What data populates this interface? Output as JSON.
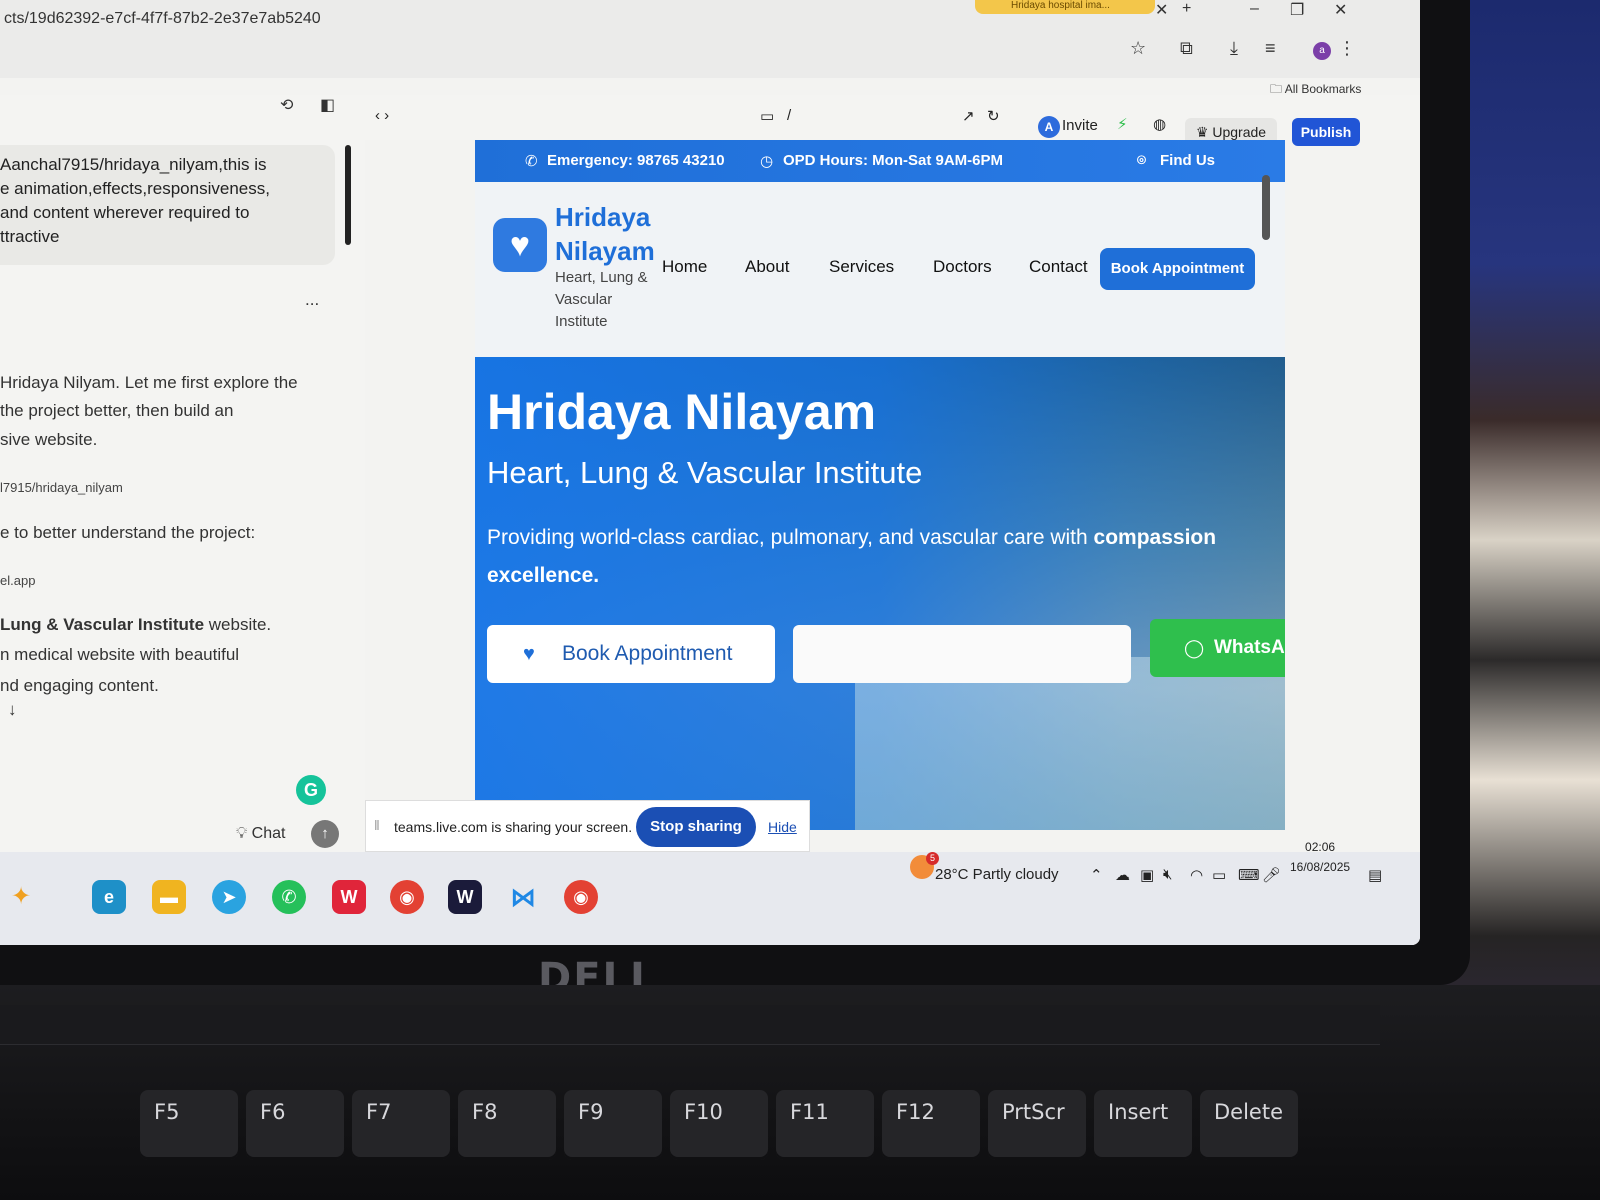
{
  "browser": {
    "url": "cts/19d62392-e7cf-4f7f-87b2-2e37e7ab5240",
    "tab_title": "Hridaya hospital ima...",
    "bookmarks_label": "All Bookmarks"
  },
  "editor": {
    "invite_label": "Invite",
    "invite_avatar": "A",
    "upgrade_label": "Upgrade",
    "publish_label": "Publish",
    "path_label": "/"
  },
  "chat": {
    "user_message": "Aanchal7915/hridaya_nilyam,this is\ne animation,effects,responsiveness,\n and content wherever required to\nttractive",
    "lines": [
      "Hridaya Nilyam. Let me first explore the",
      "the project better, then build an",
      "sive website."
    ],
    "repo_ref": "l7915/hridaya_nilyam",
    "understand_line": "e to better understand the project:",
    "app_ref": "el.app",
    "institute_bold": "Lung & Vascular Institute",
    "institute_rest": " website.",
    "medical_line": "n medical website with beautiful",
    "engaging_line": "nd engaging content.",
    "more_label": "...",
    "chat_label": "Chat"
  },
  "site": {
    "emergency": "Emergency: 98765 43210",
    "opd": "OPD Hours: Mon-Sat 9AM-6PM",
    "find_us": "Find Us",
    "brand_line1": "Hridaya",
    "brand_line2": "Nilayam",
    "brand_sub": "Heart, Lung &\nVascular\nInstitute",
    "nav": [
      "Home",
      "About",
      "Services",
      "Doctors",
      "Contact"
    ],
    "book_nav": "Book Appointment",
    "hero_title": "Hridaya Nilayam",
    "hero_subtitle": "Heart, Lung & Vascular Institute",
    "hero_desc": "Providing world-class cardiac, pulmonary, and vascular care with ",
    "hero_desc_bold1": "compassion",
    "hero_desc_bold2": "excellence.",
    "hero_book": "Book Appointment",
    "hero_whatsapp": "WhatsA"
  },
  "share": {
    "text": "teams.live.com is sharing your screen.",
    "stop": "Stop sharing",
    "hide": "Hide"
  },
  "taskbar": {
    "weather_badge": "5",
    "weather": "28°C  Partly cloudy",
    "time": "02:06",
    "date": "16/08/2025"
  },
  "keyboard": {
    "brand": "DELL",
    "keys": [
      "F5",
      "F6",
      "F7",
      "F8",
      "F9",
      "F10",
      "F11",
      "F12",
      "PrtScr",
      "Insert",
      "Delete"
    ]
  },
  "colors": {
    "brand_blue": "#1f6fd8",
    "publish_blue": "#2155d6",
    "whatsapp_green": "#2fbf4d",
    "stop_sharing_blue": "#1b4fb4"
  }
}
